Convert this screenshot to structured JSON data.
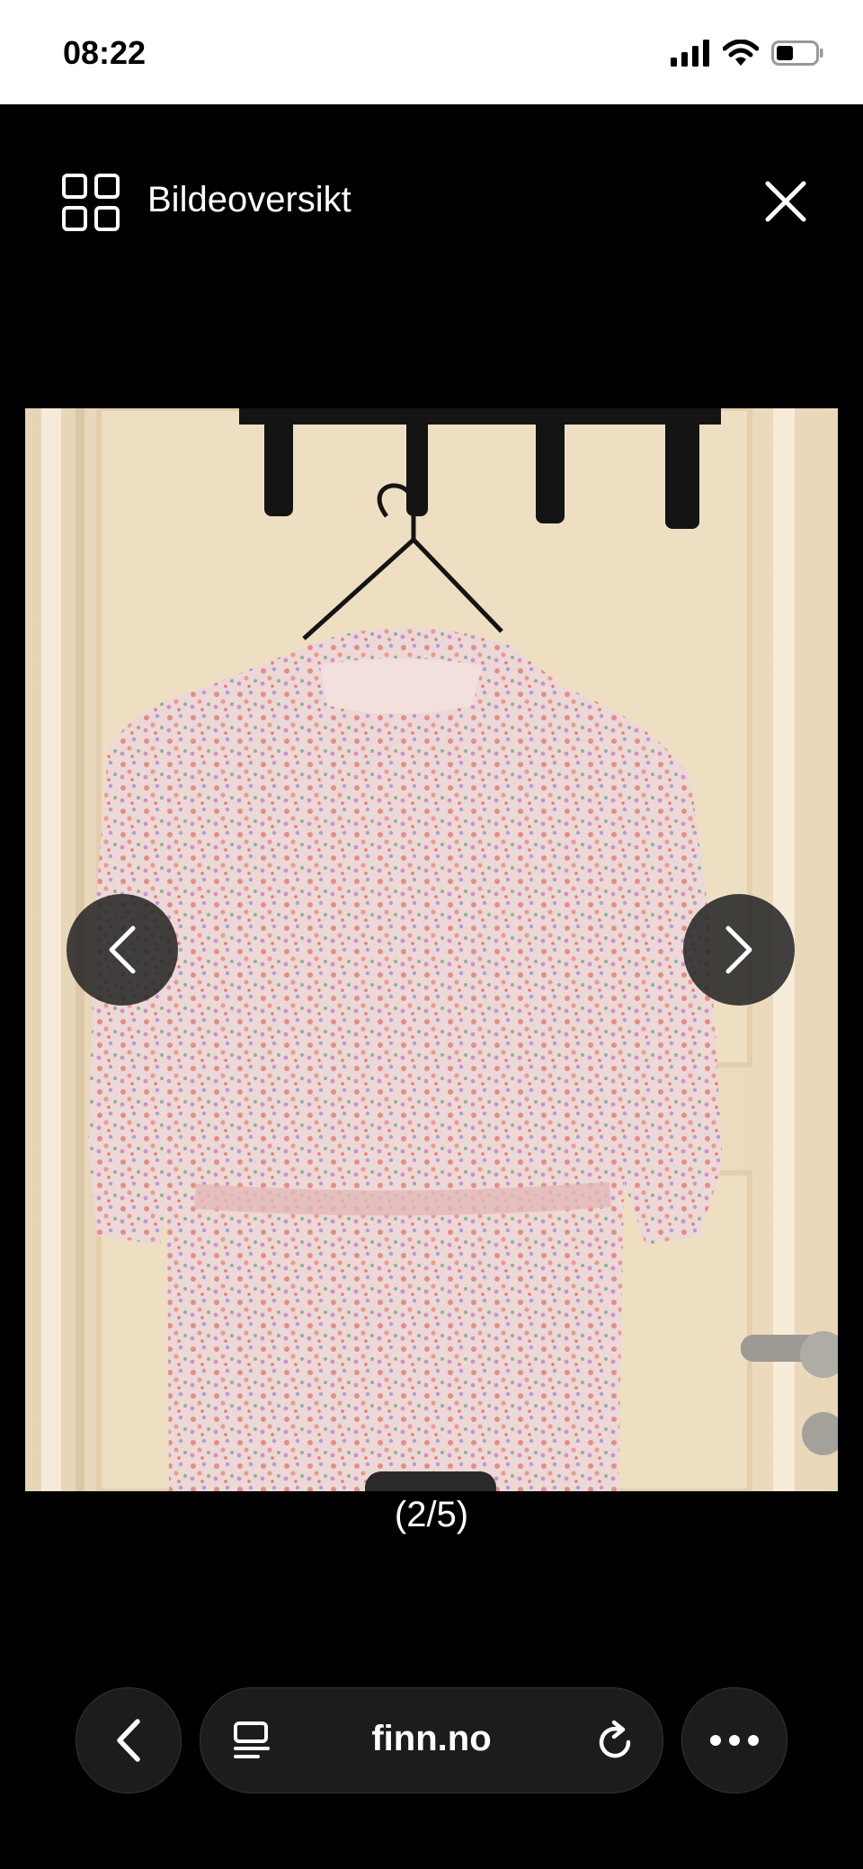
{
  "status_bar": {
    "time": "08:22",
    "icons": [
      "cellular-signal-icon",
      "wifi-icon",
      "battery-icon"
    ]
  },
  "viewer": {
    "overview_icon": "grid-icon",
    "title": "Bildeoversikt",
    "close_icon": "close-icon",
    "image_alt": "Floral dress on hanger",
    "counter": "(2/5)",
    "prev_icon": "chevron-left-icon",
    "next_icon": "chevron-right-icon"
  },
  "browser": {
    "url": "finn.no",
    "back_icon": "chevron-left-icon",
    "reader_icon": "reader-icon",
    "reload_icon": "reload-icon",
    "more_icon": "more-icon"
  },
  "colors": {
    "background": "#000000",
    "status_bar": "#ffffff",
    "control_bg": "#1c1c1e"
  }
}
